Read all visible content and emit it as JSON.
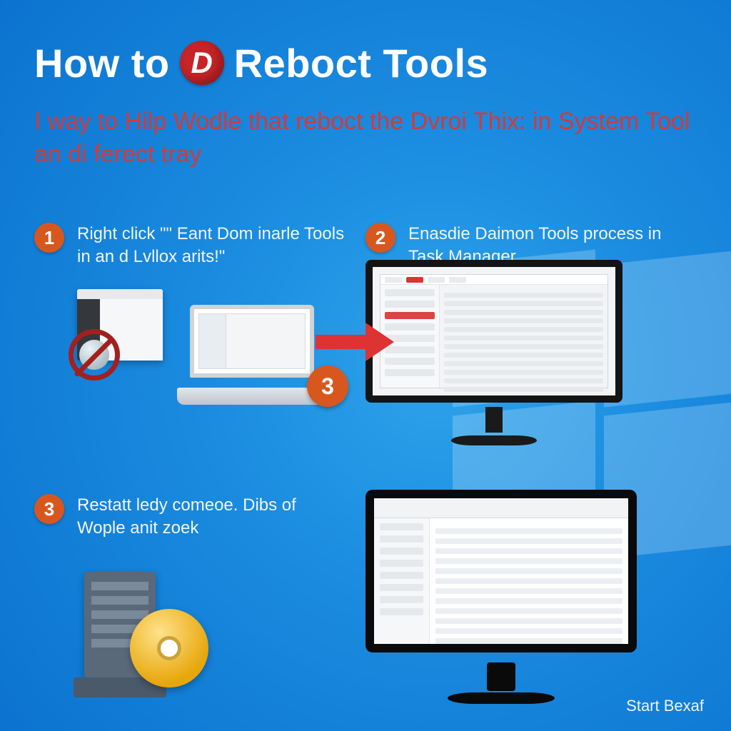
{
  "title_parts": {
    "before": "How to",
    "logo_letter": "D",
    "after": "Reboct Tools"
  },
  "subtitle": "I way to Hilp Wodle that reboct the Dvroi Thix: in System Tool an di ferect tray",
  "steps": [
    {
      "n": "1",
      "text": "Right click \"\" Eant Dom inarle Tools in an d Lvllox arits!\""
    },
    {
      "n": "2",
      "text": "Enasdie Daimon Tools process in Task Manager"
    },
    {
      "n": "3",
      "text": "Restatt ledy comeoe. Dibs of Wople anit zoek"
    }
  ],
  "floating_badge": "3",
  "footer": "Start Bexaf",
  "colors": {
    "accent_red": "#c62426",
    "badge_orange": "#d8571f",
    "subtitle_red": "#d23a3a"
  }
}
